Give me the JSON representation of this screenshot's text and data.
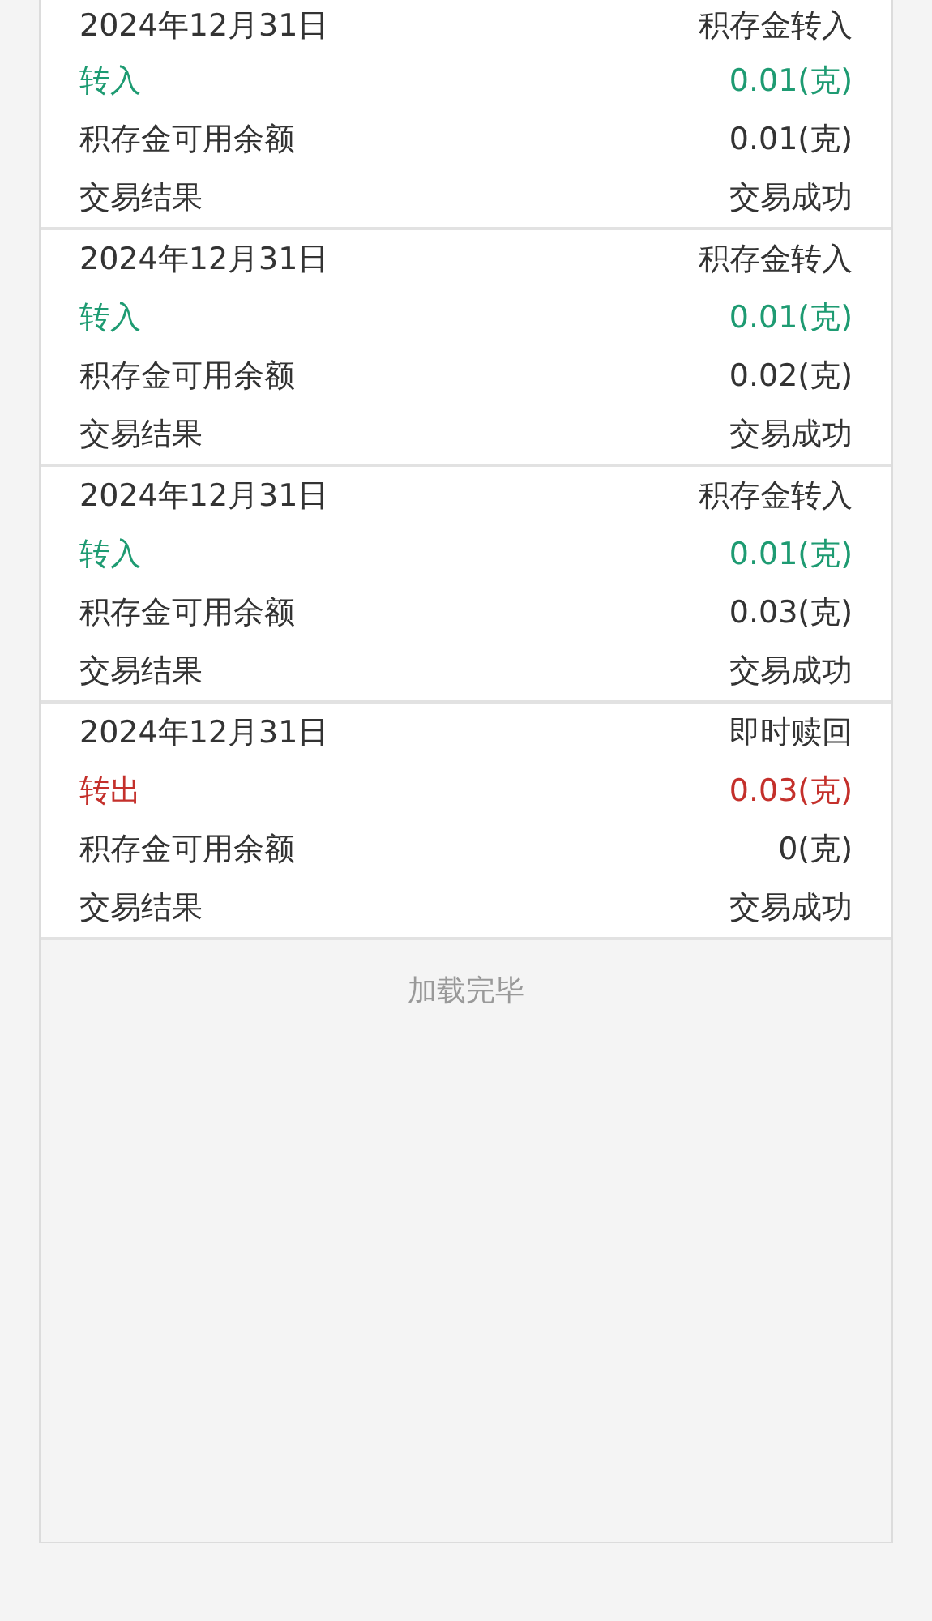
{
  "records": [
    {
      "date": "2024年12月31日",
      "type": "积存金转入",
      "direction": "转入",
      "kind": "in",
      "amount": "0.01(克)",
      "balance_label": "积存金可用余额",
      "balance": "0.01(克)",
      "result_label": "交易结果",
      "result": "交易成功"
    },
    {
      "date": "2024年12月31日",
      "type": "积存金转入",
      "direction": "转入",
      "kind": "in",
      "amount": "0.01(克)",
      "balance_label": "积存金可用余额",
      "balance": "0.02(克)",
      "result_label": "交易结果",
      "result": "交易成功"
    },
    {
      "date": "2024年12月31日",
      "type": "积存金转入",
      "direction": "转入",
      "kind": "in",
      "amount": "0.01(克)",
      "balance_label": "积存金可用余额",
      "balance": "0.03(克)",
      "result_label": "交易结果",
      "result": "交易成功"
    },
    {
      "date": "2024年12月31日",
      "type": "即时赎回",
      "direction": "转出",
      "kind": "out",
      "amount": "0.03(克)",
      "balance_label": "积存金可用余额",
      "balance": "0(克)",
      "result_label": "交易结果",
      "result": "交易成功"
    }
  ],
  "footer": "加载完毕"
}
